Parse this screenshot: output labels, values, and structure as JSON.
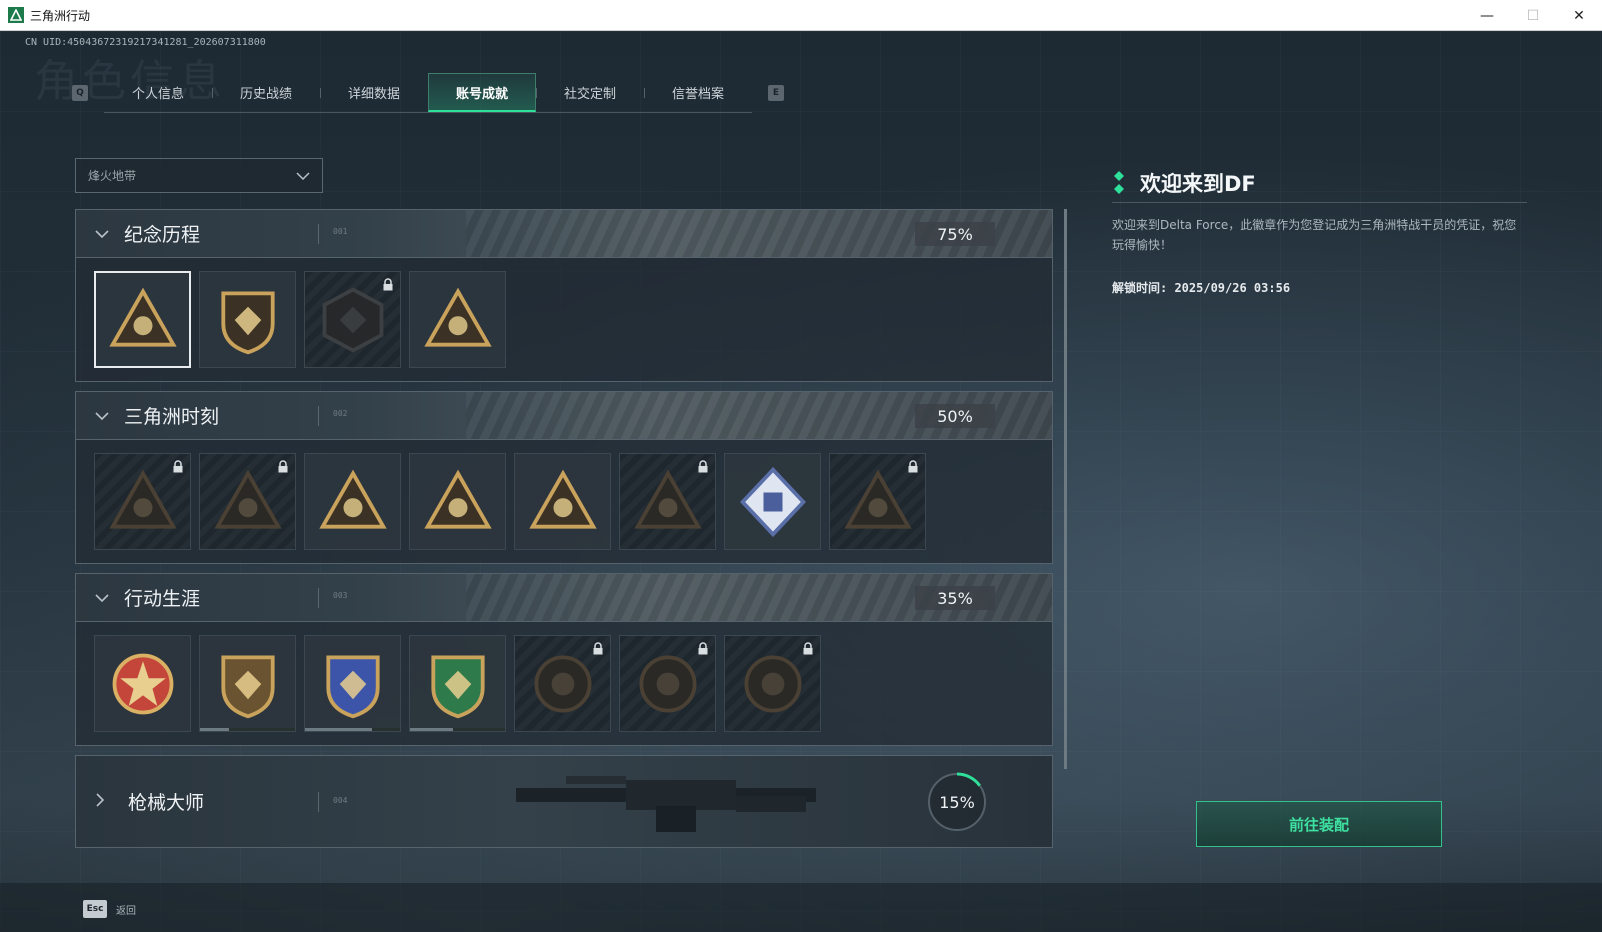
{
  "window": {
    "title": "三角洲行动",
    "minimize": "—",
    "maximize": "☐",
    "close": "✕"
  },
  "uid": "CN UID:4504367231921734128​1_202607311800",
  "ghost_title": "角色信息",
  "tabs": {
    "prev_key": "Q",
    "next_key": "E",
    "items": [
      "个人信息",
      "历史战绩",
      "详细数据",
      "账号成就",
      "社交定制",
      "信誉档案"
    ],
    "active_index": 3
  },
  "filter": {
    "value": "烽火地带"
  },
  "categories": [
    {
      "title": "纪念历程",
      "code": "001",
      "percent": "75%",
      "expanded": true,
      "badges": [
        {
          "icon": "triangle-shield-badge",
          "locked": false,
          "selected": true
        },
        {
          "icon": "helicopter-shield-badge",
          "locked": false
        },
        {
          "icon": "hexagon-emblem-badge",
          "locked": true
        },
        {
          "icon": "number-one-triangle-badge",
          "locked": false
        }
      ]
    },
    {
      "title": "三角洲时刻",
      "code": "002",
      "percent": "50%",
      "expanded": true,
      "badges": [
        {
          "icon": "crate-triangle-badge",
          "locked": true
        },
        {
          "icon": "soldier-triangle-badge",
          "locked": true
        },
        {
          "icon": "cyber-triangle-badge",
          "locked": false
        },
        {
          "icon": "squad-triangle-badge",
          "locked": false
        },
        {
          "icon": "team-triangle-badge",
          "locked": false
        },
        {
          "icon": "fish-triangle-badge",
          "locked": true
        },
        {
          "icon": "cube-diamond-badge",
          "locked": false
        },
        {
          "icon": "snake-triangle-badge",
          "locked": true
        }
      ]
    },
    {
      "title": "行动生涯",
      "code": "003",
      "percent": "35%",
      "expanded": true,
      "badges": [
        {
          "icon": "star-wings-badge",
          "locked": false
        },
        {
          "icon": "bronze-shield-badge",
          "locked": false,
          "progress": 0.3
        },
        {
          "icon": "blue-shield-badge",
          "locked": false,
          "progress": 0.7
        },
        {
          "icon": "green-shield-badge",
          "locked": false,
          "progress": 0.45
        },
        {
          "icon": "ring-emblem-badge",
          "locked": true
        },
        {
          "icon": "crosshair-emblem-badge",
          "locked": true
        },
        {
          "icon": "eye-emblem-badge",
          "locked": true
        }
      ]
    },
    {
      "title": "枪械大师",
      "code": "004",
      "percent": "15%",
      "progress": 0.15,
      "expanded": false
    }
  ],
  "detail": {
    "title": "欢迎来到DF",
    "description": "欢迎来到Delta Force，此徽章作为您登记成为三角洲特战干员的凭证，祝您玩得愉快！",
    "unlock_label": "解锁时间: 2025/09/26 03:56"
  },
  "equip_button": "前往装配",
  "footer": {
    "esc_key": "Esc",
    "back_label": "返回"
  },
  "colors": {
    "accent": "#2fe09a",
    "panel": "#222c34",
    "border": "#56636c"
  }
}
